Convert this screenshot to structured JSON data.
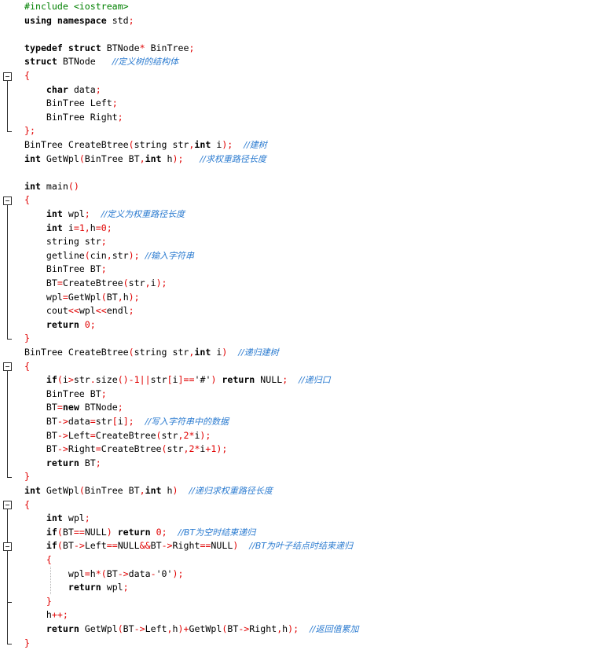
{
  "window": {
    "title": ""
  },
  "code_lines": [
    [
      [
        "pre",
        "#include <iostream>"
      ]
    ],
    [
      [
        "kw",
        "using namespace "
      ],
      [
        "id",
        "std"
      ],
      [
        "op",
        ";"
      ]
    ],
    [],
    [
      [
        "kw",
        "typedef struct "
      ],
      [
        "id",
        "BTNode"
      ],
      [
        "op",
        "* "
      ],
      [
        "id",
        "BinTree"
      ],
      [
        "op",
        ";"
      ]
    ],
    [
      [
        "kw",
        "struct "
      ],
      [
        "id",
        "BTNode   "
      ],
      [
        "comment",
        "//定义树的结构体"
      ]
    ],
    [
      [
        "op",
        "{"
      ]
    ],
    [
      [
        "id",
        "    "
      ],
      [
        "kw",
        "char "
      ],
      [
        "id",
        "data"
      ],
      [
        "op",
        ";"
      ]
    ],
    [
      [
        "id",
        "    BinTree Left"
      ],
      [
        "op",
        ";"
      ]
    ],
    [
      [
        "id",
        "    BinTree Right"
      ],
      [
        "op",
        ";"
      ]
    ],
    [
      [
        "op",
        "};"
      ]
    ],
    [
      [
        "id",
        "BinTree CreateBtree"
      ],
      [
        "op",
        "("
      ],
      [
        "id",
        "string str"
      ],
      [
        "op",
        ","
      ],
      [
        "kw",
        "int "
      ],
      [
        "id",
        "i"
      ],
      [
        "op",
        ");  "
      ],
      [
        "comment",
        "//建树"
      ]
    ],
    [
      [
        "kw",
        "int "
      ],
      [
        "id",
        "GetWpl"
      ],
      [
        "op",
        "("
      ],
      [
        "id",
        "BinTree BT"
      ],
      [
        "op",
        ","
      ],
      [
        "kw",
        "int "
      ],
      [
        "id",
        "h"
      ],
      [
        "op",
        ");   "
      ],
      [
        "comment",
        "//求权重路径长度"
      ]
    ],
    [],
    [
      [
        "kw",
        "int "
      ],
      [
        "id",
        "main"
      ],
      [
        "op",
        "()"
      ]
    ],
    [
      [
        "op",
        "{"
      ]
    ],
    [
      [
        "id",
        "    "
      ],
      [
        "kw",
        "int "
      ],
      [
        "id",
        "wpl"
      ],
      [
        "op",
        ";  "
      ],
      [
        "comment",
        "//定义为权重路径长度"
      ]
    ],
    [
      [
        "id",
        "    "
      ],
      [
        "kw",
        "int "
      ],
      [
        "id",
        "i"
      ],
      [
        "op",
        "="
      ],
      [
        "num",
        "1"
      ],
      [
        "op",
        ","
      ],
      [
        "id",
        "h"
      ],
      [
        "op",
        "="
      ],
      [
        "num",
        "0"
      ],
      [
        "op",
        ";"
      ]
    ],
    [
      [
        "id",
        "    string str"
      ],
      [
        "op",
        ";"
      ]
    ],
    [
      [
        "id",
        "    getline"
      ],
      [
        "op",
        "("
      ],
      [
        "id",
        "cin"
      ],
      [
        "op",
        ","
      ],
      [
        "id",
        "str"
      ],
      [
        "op",
        ");"
      ],
      [
        "id",
        " "
      ],
      [
        "comment",
        "//输入字符串"
      ]
    ],
    [
      [
        "id",
        "    BinTree BT"
      ],
      [
        "op",
        ";"
      ]
    ],
    [
      [
        "id",
        "    BT"
      ],
      [
        "op",
        "="
      ],
      [
        "id",
        "CreateBtree"
      ],
      [
        "op",
        "("
      ],
      [
        "id",
        "str"
      ],
      [
        "op",
        ","
      ],
      [
        "id",
        "i"
      ],
      [
        "op",
        ");"
      ]
    ],
    [
      [
        "id",
        "    wpl"
      ],
      [
        "op",
        "="
      ],
      [
        "id",
        "GetWpl"
      ],
      [
        "op",
        "("
      ],
      [
        "id",
        "BT"
      ],
      [
        "op",
        ","
      ],
      [
        "id",
        "h"
      ],
      [
        "op",
        ");"
      ]
    ],
    [
      [
        "id",
        "    cout"
      ],
      [
        "op",
        "<<"
      ],
      [
        "id",
        "wpl"
      ],
      [
        "op",
        "<<"
      ],
      [
        "id",
        "endl"
      ],
      [
        "op",
        ";"
      ]
    ],
    [
      [
        "id",
        "    "
      ],
      [
        "kw",
        "return "
      ],
      [
        "num",
        "0"
      ],
      [
        "op",
        ";"
      ]
    ],
    [
      [
        "op",
        "}"
      ]
    ],
    [
      [
        "id",
        "BinTree CreateBtree"
      ],
      [
        "op",
        "("
      ],
      [
        "id",
        "string str"
      ],
      [
        "op",
        ","
      ],
      [
        "kw",
        "int "
      ],
      [
        "id",
        "i"
      ],
      [
        "op",
        ")  "
      ],
      [
        "comment",
        "//递归建树"
      ]
    ],
    [
      [
        "op",
        "{"
      ]
    ],
    [
      [
        "id",
        "    "
      ],
      [
        "kw",
        "if"
      ],
      [
        "op",
        "("
      ],
      [
        "id",
        "i"
      ],
      [
        "op",
        ">"
      ],
      [
        "id",
        "str"
      ],
      [
        "op",
        "."
      ],
      [
        "id",
        "size"
      ],
      [
        "op",
        "()-"
      ],
      [
        "num",
        "1"
      ],
      [
        "op",
        "||"
      ],
      [
        "id",
        "str"
      ],
      [
        "op",
        "["
      ],
      [
        "id",
        "i"
      ],
      [
        "op",
        "]=="
      ],
      [
        "str",
        "'#'"
      ],
      [
        "op",
        ") "
      ],
      [
        "kw",
        "return "
      ],
      [
        "id",
        "NULL"
      ],
      [
        "op",
        ";  "
      ],
      [
        "comment",
        "//递归口"
      ]
    ],
    [
      [
        "id",
        "    BinTree BT"
      ],
      [
        "op",
        ";"
      ]
    ],
    [
      [
        "id",
        "    BT"
      ],
      [
        "op",
        "="
      ],
      [
        "kw",
        "new "
      ],
      [
        "id",
        "BTNode"
      ],
      [
        "op",
        ";"
      ]
    ],
    [
      [
        "id",
        "    BT"
      ],
      [
        "op",
        "->"
      ],
      [
        "id",
        "data"
      ],
      [
        "op",
        "="
      ],
      [
        "id",
        "str"
      ],
      [
        "op",
        "["
      ],
      [
        "id",
        "i"
      ],
      [
        "op",
        "];"
      ],
      [
        "id",
        "  "
      ],
      [
        "comment",
        "//写入字符串中的数据"
      ]
    ],
    [
      [
        "id",
        "    BT"
      ],
      [
        "op",
        "->"
      ],
      [
        "id",
        "Left"
      ],
      [
        "op",
        "="
      ],
      [
        "id",
        "CreateBtree"
      ],
      [
        "op",
        "("
      ],
      [
        "id",
        "str"
      ],
      [
        "op",
        ","
      ],
      [
        "num",
        "2"
      ],
      [
        "op",
        "*"
      ],
      [
        "id",
        "i"
      ],
      [
        "op",
        ");"
      ]
    ],
    [
      [
        "id",
        "    BT"
      ],
      [
        "op",
        "->"
      ],
      [
        "id",
        "Right"
      ],
      [
        "op",
        "="
      ],
      [
        "id",
        "CreateBtree"
      ],
      [
        "op",
        "("
      ],
      [
        "id",
        "str"
      ],
      [
        "op",
        ","
      ],
      [
        "num",
        "2"
      ],
      [
        "op",
        "*"
      ],
      [
        "id",
        "i"
      ],
      [
        "op",
        "+"
      ],
      [
        "num",
        "1"
      ],
      [
        "op",
        ");"
      ]
    ],
    [
      [
        "id",
        "    "
      ],
      [
        "kw",
        "return "
      ],
      [
        "id",
        "BT"
      ],
      [
        "op",
        ";"
      ]
    ],
    [
      [
        "op",
        "}"
      ]
    ],
    [
      [
        "kw",
        "int "
      ],
      [
        "id",
        "GetWpl"
      ],
      [
        "op",
        "("
      ],
      [
        "id",
        "BinTree BT"
      ],
      [
        "op",
        ","
      ],
      [
        "kw",
        "int "
      ],
      [
        "id",
        "h"
      ],
      [
        "op",
        ")  "
      ],
      [
        "comment",
        "//递归求权重路径长度"
      ]
    ],
    [
      [
        "op",
        "{"
      ]
    ],
    [
      [
        "id",
        "    "
      ],
      [
        "kw",
        "int "
      ],
      [
        "id",
        "wpl"
      ],
      [
        "op",
        ";"
      ]
    ],
    [
      [
        "id",
        "    "
      ],
      [
        "kw",
        "if"
      ],
      [
        "op",
        "("
      ],
      [
        "id",
        "BT"
      ],
      [
        "op",
        "=="
      ],
      [
        "id",
        "NULL"
      ],
      [
        "op",
        ") "
      ],
      [
        "kw",
        "return "
      ],
      [
        "num",
        "0"
      ],
      [
        "op",
        ";  "
      ],
      [
        "comment",
        "//BT为空时结束递归"
      ]
    ],
    [
      [
        "id",
        "    "
      ],
      [
        "kw",
        "if"
      ],
      [
        "op",
        "("
      ],
      [
        "id",
        "BT"
      ],
      [
        "op",
        "->"
      ],
      [
        "id",
        "Left"
      ],
      [
        "op",
        "=="
      ],
      [
        "id",
        "NULL"
      ],
      [
        "op",
        "&&"
      ],
      [
        "id",
        "BT"
      ],
      [
        "op",
        "->"
      ],
      [
        "id",
        "Right"
      ],
      [
        "op",
        "=="
      ],
      [
        "id",
        "NULL"
      ],
      [
        "op",
        ")  "
      ],
      [
        "comment",
        "//BT为叶子结点时结束递归"
      ]
    ],
    [
      [
        "id",
        "    "
      ],
      [
        "op",
        "{"
      ]
    ],
    [
      [
        "id",
        "        wpl"
      ],
      [
        "op",
        "="
      ],
      [
        "id",
        "h"
      ],
      [
        "op",
        "*("
      ],
      [
        "id",
        "BT"
      ],
      [
        "op",
        "->"
      ],
      [
        "id",
        "data"
      ],
      [
        "op",
        "-"
      ],
      [
        "str",
        "'0'"
      ],
      [
        "op",
        ");"
      ]
    ],
    [
      [
        "id",
        "        "
      ],
      [
        "kw",
        "return "
      ],
      [
        "id",
        "wpl"
      ],
      [
        "op",
        ";"
      ]
    ],
    [
      [
        "id",
        "    "
      ],
      [
        "op",
        "}"
      ]
    ],
    [
      [
        "id",
        "    h"
      ],
      [
        "op",
        "++;"
      ]
    ],
    [
      [
        "id",
        "    "
      ],
      [
        "kw",
        "return "
      ],
      [
        "id",
        "GetWpl"
      ],
      [
        "op",
        "("
      ],
      [
        "id",
        "BT"
      ],
      [
        "op",
        "->"
      ],
      [
        "id",
        "Left"
      ],
      [
        "op",
        ","
      ],
      [
        "id",
        "h"
      ],
      [
        "op",
        ")+"
      ],
      [
        "id",
        "GetWpl"
      ],
      [
        "op",
        "("
      ],
      [
        "id",
        "BT"
      ],
      [
        "op",
        "->"
      ],
      [
        "id",
        "Right"
      ],
      [
        "op",
        ","
      ],
      [
        "id",
        "h"
      ],
      [
        "op",
        ");  "
      ],
      [
        "comment",
        "//返回值累加"
      ]
    ],
    [
      [
        "op",
        "}"
      ]
    ]
  ]
}
